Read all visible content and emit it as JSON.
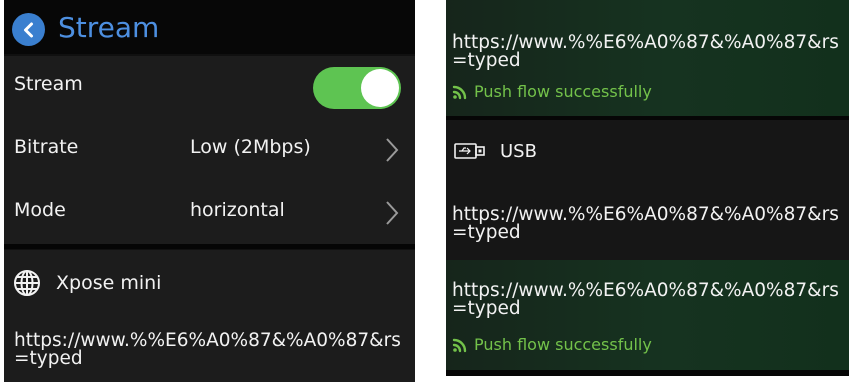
{
  "left": {
    "header": {
      "title": "Stream"
    },
    "settings": {
      "stream": {
        "label": "Stream",
        "enabled": true
      },
      "bitrate": {
        "label": "Bitrate",
        "value": "Low (2Mbps)"
      },
      "mode": {
        "label": "Mode",
        "value": "horizontal"
      }
    },
    "device": {
      "name": "Xpose mini",
      "url": "https://www.%%E6%A0%87&%A0%87&rs=typed"
    }
  },
  "right": {
    "card1": {
      "url": "https://www.%%E6%A0%87&%A0%87&rs=typed",
      "status": "Push flow successfully"
    },
    "usb": {
      "label": "USB",
      "url": "https://www.%%E6%A0%87&%A0%87&rs=typed"
    },
    "card2": {
      "url": "https://www.%%E6%A0%87&%A0%87&rs=typed",
      "status": "Push flow successfully"
    }
  },
  "colors": {
    "accent": "#4d8fe0",
    "toggle_on": "#5ec452",
    "success": "#73c24a"
  },
  "icons": [
    "back-icon",
    "chevron-right-icon",
    "globe-icon",
    "signal-icon",
    "usb-icon"
  ]
}
